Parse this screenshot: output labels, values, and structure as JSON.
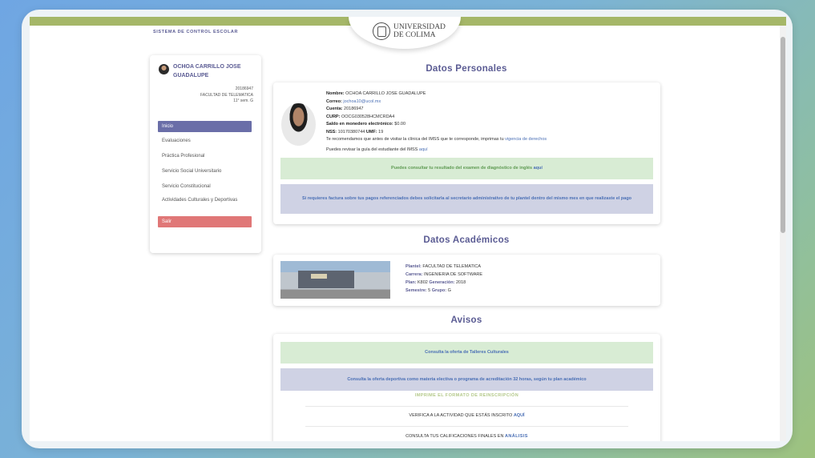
{
  "header": {
    "system_name": "SISTEMA DE CONTROL ESCOLAR",
    "logo_line1": "UNIVERSIDAD",
    "logo_line2": "DE COLIMA"
  },
  "sidebar": {
    "user_name": "OCHOA CARRILLO JOSE GUADALUPE",
    "account": "20186947",
    "faculty": "FACULTAD DE TELEMATICA",
    "semester": "11° sem. G",
    "items": [
      {
        "label": "Inicio"
      },
      {
        "label": "Evaluaciones"
      },
      {
        "label": "Práctica Profesional"
      },
      {
        "label": "Servicio Social Universitario"
      },
      {
        "label": "Servicio Constitucional"
      },
      {
        "label": "Actividades Culturales y Deportivas"
      }
    ],
    "exit_label": "Salir"
  },
  "personal": {
    "title": "Datos Personales",
    "nombre_label": "Nombre:",
    "nombre": "OCHOA CARRILLO JOSE GUADALUPE",
    "correo_label": "Correo:",
    "correo": "jochoa10@ucol.mx",
    "cuenta_label": "Cuenta:",
    "cuenta": "20186947",
    "curp_label": "CURP:",
    "curp": "OOCG030528HCMCRDA4",
    "saldo_label": "Saldo en monedero electrónico:",
    "saldo": "$0.00",
    "nss_label": "NSS:",
    "nss": "10170380744",
    "umf_label": "UMF:",
    "umf": "19",
    "imss_text": "Te recomendamos que antes de visitar la clínica del IMSS que te corresponde, imprimas tu",
    "imss_link": "vigencia de derechos",
    "guide_text": "Puedes revisar la guía del estudiante del IMSS",
    "guide_link": "aquí",
    "alert_english": "Puedes consultar tu resultado del examen de diagnóstico de inglés",
    "alert_english_link": "aquí",
    "alert_invoice": "Si requieres factura sobre tus pagos referenciados debes solicitarla al secretario administrativo de tu plantel dentro del mismo mes en que realizaste el pago"
  },
  "academic": {
    "title": "Datos Académicos",
    "plantel_label": "Plantel:",
    "plantel": "FACULTAD DE TELEMATICA",
    "carrera_label": "Carrera:",
    "carrera": "INGENIERIA DE SOFTWARE",
    "plan_label": "Plan:",
    "plan": "K802",
    "generacion_label": "Generación:",
    "generacion": "2018",
    "semestre_label": "Semestre:",
    "semestre": "5",
    "grupo_label": "Grupo:",
    "grupo": "G"
  },
  "avisos": {
    "title": "Avisos",
    "talleres": "Consulta la oferta de Talleres Culturales",
    "deportiva": "Consulta la oferta deportiva como materia electiva o programa de acreditación 32 horas, según tu plan académico",
    "reinscripcion": "IMPRIME EL FORMATO DE REINSCRIPCIÓN",
    "actividad_text": "VERIFICA A LA ACTIVIDAD QUE ESTÁS INSCRITO",
    "actividad_link": "AQUÍ",
    "calificaciones_text": "CONSULTA TUS CALIFICACIONES FINALES EN",
    "calificaciones_link": "ANÁLISIS"
  }
}
